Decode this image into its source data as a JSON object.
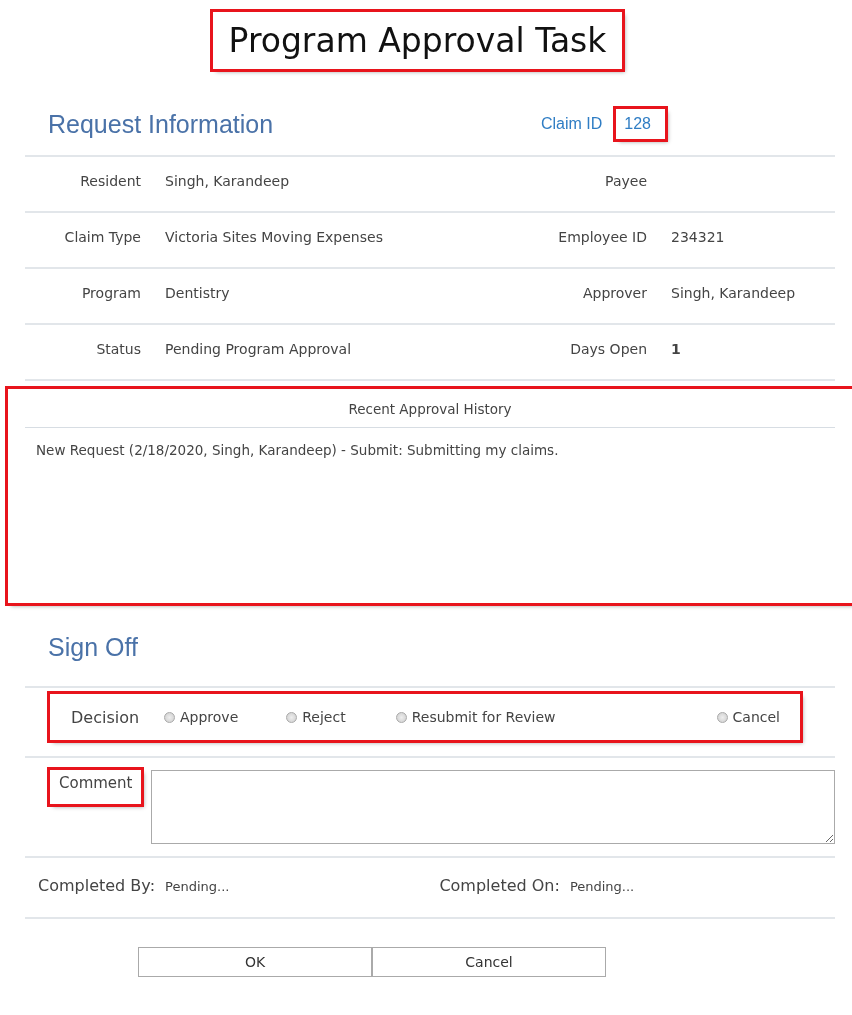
{
  "title": {
    "text": "Program Approval Task",
    "highlighted": true
  },
  "request": {
    "heading": "Request Information",
    "claim_id_label": "Claim ID",
    "claim_id": "128",
    "claim_id_highlighted": true,
    "rows": [
      {
        "left_label": "Resident",
        "left_value": "Singh, Karandeep",
        "right_label": "Payee",
        "right_value": null
      },
      {
        "left_label": "Claim Type",
        "left_value": "Victoria Sites Moving Expenses",
        "right_label": "Employee ID",
        "right_value": "234321"
      },
      {
        "left_label": "Program",
        "left_value": "Dentistry",
        "right_label": "Approver",
        "right_value": "Singh, Karandeep"
      },
      {
        "left_label": "Status",
        "left_value": "Pending Program Approval",
        "right_label": "Days Open",
        "right_value": "1",
        "right_bold": true
      }
    ]
  },
  "history": {
    "title": "Recent Approval History",
    "highlighted": true,
    "entries": [
      "New Request (2/18/2020, Singh, Karandeep) - Submit:  Submitting my claims."
    ]
  },
  "sign_off": {
    "heading": "Sign Off",
    "decision_label": "Decision",
    "decision_highlighted": true,
    "options": [
      {
        "label": "Approve",
        "selected": false
      },
      {
        "label": "Reject",
        "selected": false
      },
      {
        "label": "Resubmit for Review",
        "selected": false
      },
      {
        "label": "Cancel",
        "selected": false
      }
    ],
    "comment_label": "Comment",
    "comment_highlighted": true,
    "completed_by_label": "Completed By:",
    "completed_by": "Pending...",
    "completed_on_label": "Completed On:",
    "completed_on": "Pending..."
  },
  "buttons": [
    "OK",
    "Cancel"
  ]
}
